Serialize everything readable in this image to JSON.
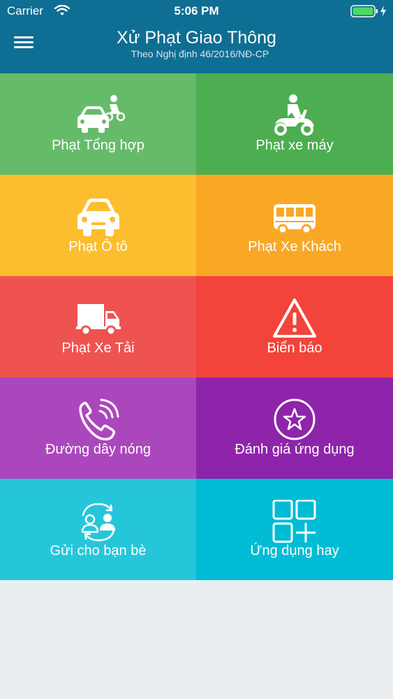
{
  "status_bar": {
    "carrier": "Carrier",
    "time": "5:06 PM"
  },
  "header": {
    "title": "Xử Phạt Giao Thông",
    "subtitle": "Theo Nghị định 46/2016/NĐ-CP"
  },
  "tiles": [
    {
      "label": "Phạt Tổng hợp",
      "icon": "car-motorbike-icon",
      "color": "#66bb6a"
    },
    {
      "label": "Phạt xe máy",
      "icon": "scooter-icon",
      "color": "#4cae50"
    },
    {
      "label": "Phạt Ô tô",
      "icon": "car-icon",
      "color": "#fcbe2e"
    },
    {
      "label": "Phạt Xe Khách",
      "icon": "bus-icon",
      "color": "#f9a826"
    },
    {
      "label": "Phạt Xe Tải",
      "icon": "truck-icon",
      "color": "#ef5350"
    },
    {
      "label": "Biển báo",
      "icon": "warning-icon",
      "color": "#f2443a"
    },
    {
      "label": "Đường dây nóng",
      "icon": "phone-icon",
      "color": "#ab47bc"
    },
    {
      "label": "Đánh giá ứng dụng",
      "icon": "star-icon",
      "color": "#8e24aa"
    },
    {
      "label": "Gửi cho bạn bè",
      "icon": "share-users-icon",
      "color": "#26c6da"
    },
    {
      "label": "Ứng dụng hay",
      "icon": "apps-icon",
      "color": "#00bcd4"
    }
  ],
  "colors": {
    "header": "#0f6e93",
    "background": "#ebeef0"
  }
}
